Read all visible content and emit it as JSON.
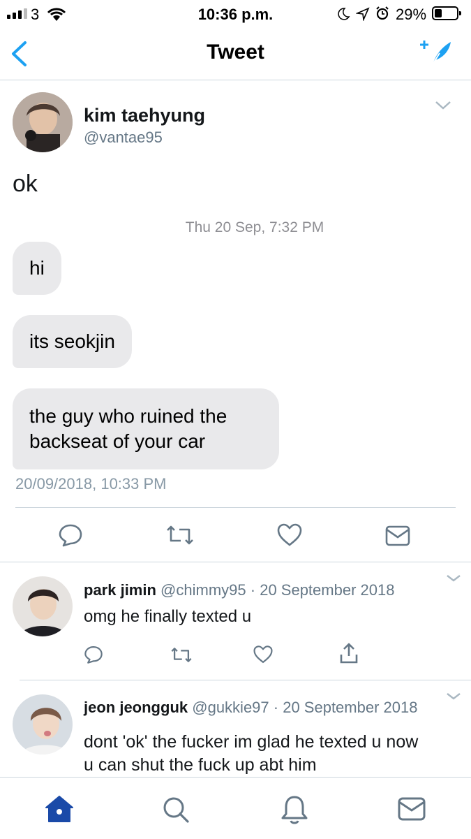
{
  "status_bar": {
    "carrier": "3",
    "time": "10:36 p.m.",
    "battery": "29%"
  },
  "nav": {
    "title": "Tweet"
  },
  "tweet": {
    "author_name": "kim taehyung",
    "author_handle": "@vantae95",
    "text": "ok",
    "attachment": {
      "date_header": "Thu 20 Sep, 7:32 PM",
      "messages": [
        "hi",
        "its seokjin",
        "the guy who ruined the backseat of your car"
      ]
    },
    "timestamp": "20/09/2018, 10:33 PM"
  },
  "replies": [
    {
      "name": "park jimin",
      "handle": "@chimmy95",
      "date": "· 20 September 2018",
      "text": "omg he finally texted u"
    },
    {
      "name": "jeon jeongguk",
      "handle": "@gukkie97",
      "date": "· 20 September 2018",
      "text": "dont 'ok' the fucker im glad he texted u now u can shut the fuck up abt him"
    }
  ],
  "colors": {
    "accent": "#1da1f2",
    "home_active": "#1a4aa8",
    "icon_gray": "#657786",
    "bubble": "#e9e9eb"
  },
  "icons": [
    "back-arrow-icon",
    "compose-tweet-icon",
    "reply-icon",
    "retweet-icon",
    "like-icon",
    "dm-icon",
    "share-icon",
    "home-icon",
    "search-icon",
    "notifications-icon",
    "messages-icon"
  ]
}
